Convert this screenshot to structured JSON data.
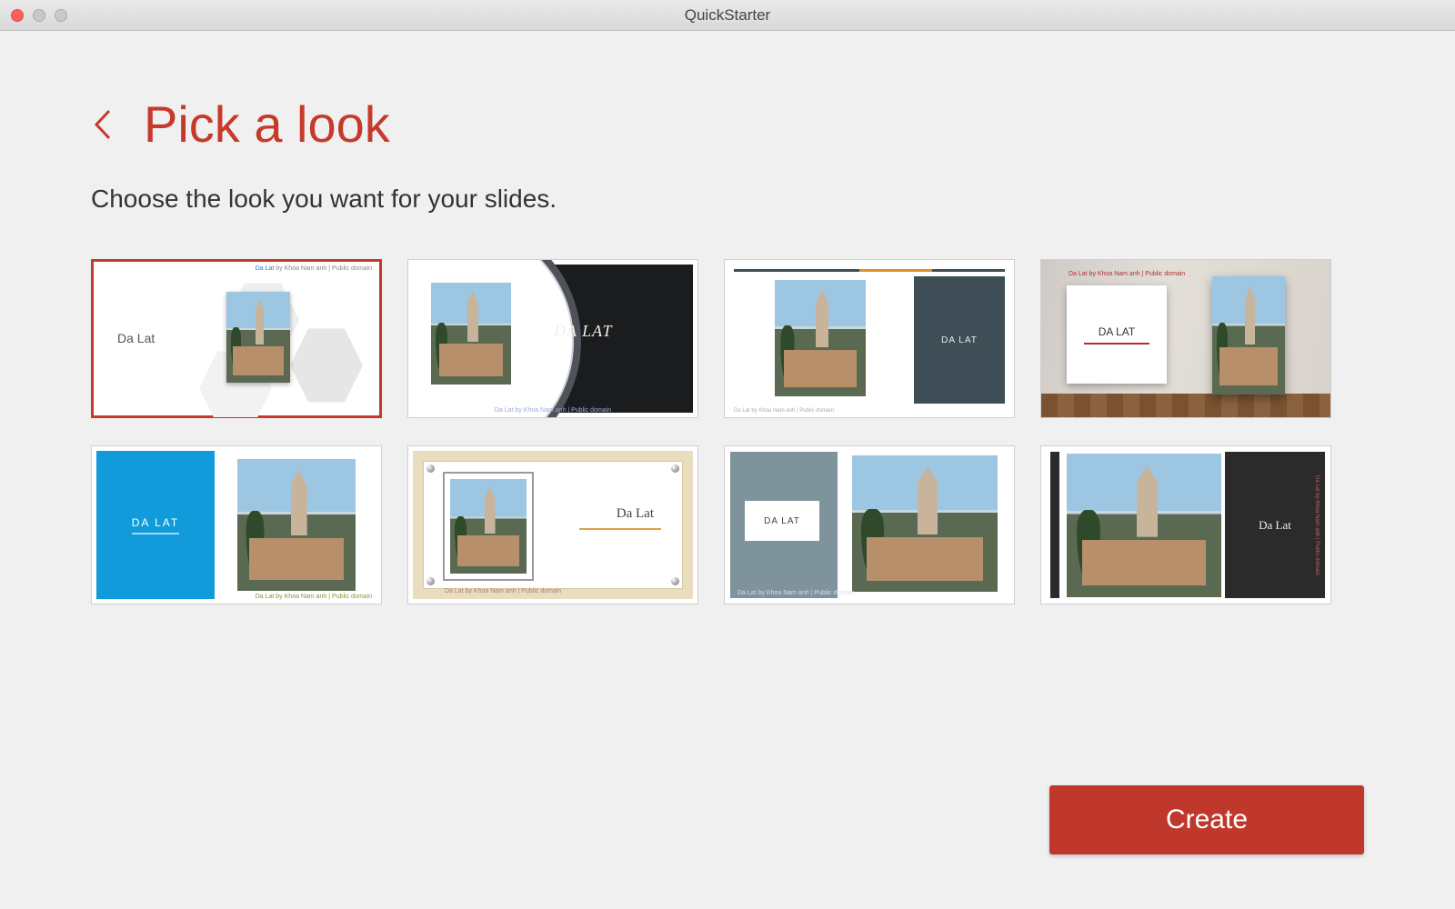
{
  "window": {
    "title": "QuickStarter"
  },
  "header": {
    "title": "Pick a look",
    "subtitle": "Choose the look you want for your slides."
  },
  "templates": [
    {
      "title": "Da Lat",
      "selected": true,
      "credit_prefix": "Da Lat",
      "credit": " by Khoa Nam anh | Public domain"
    },
    {
      "title": "DA LAT",
      "selected": false,
      "credit_prefix": "Da Lat",
      "credit": " by Khoa Nam anh | Public domain"
    },
    {
      "title": "DA LAT",
      "selected": false,
      "credit_prefix": "Da Lat",
      "credit": " by Khoa Nam anh | Public domain"
    },
    {
      "title": "DA LAT",
      "selected": false,
      "credit_prefix": "Da Lat",
      "credit": " by Khoa Nam anh | Public domain"
    },
    {
      "title": "DA LAT",
      "selected": false,
      "credit_prefix": "Da Lat",
      "credit": " by Khoa Nam anh | Public domain"
    },
    {
      "title": "Da Lat",
      "selected": false,
      "credit_prefix": "Da Lat",
      "credit": " by Khoa Nam anh | Public domain"
    },
    {
      "title": "DA LAT",
      "selected": false,
      "credit_prefix": "Da Lat",
      "credit": " by Khoa Nam anh | Public domain"
    },
    {
      "title": "Da Lat",
      "selected": false,
      "credit_prefix": "Da Lat",
      "credit": " by Khoa Nam anh | Public domain"
    }
  ],
  "actions": {
    "create": "Create"
  },
  "colors": {
    "accent": "#c0382b"
  }
}
